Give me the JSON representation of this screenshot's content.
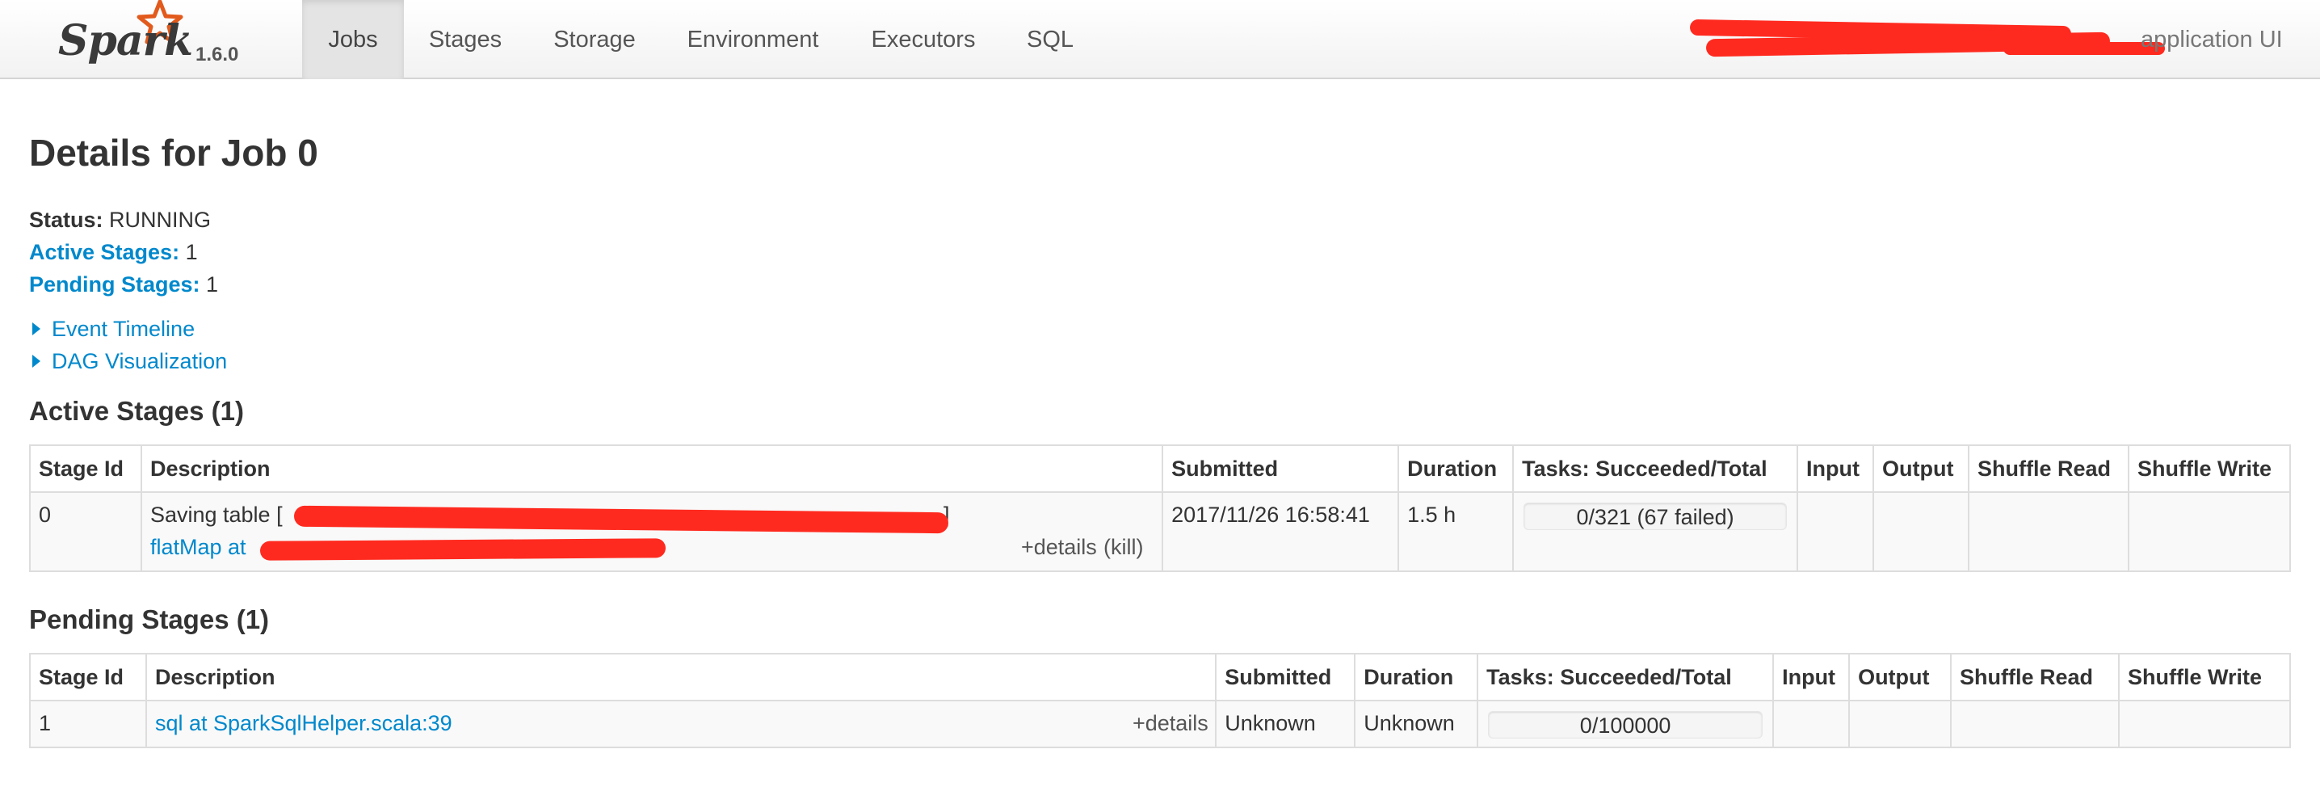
{
  "navbar": {
    "brand_name": "Spark",
    "brand_version": "1.6.0",
    "tabs": [
      "Jobs",
      "Stages",
      "Storage",
      "Environment",
      "Executors",
      "SQL"
    ],
    "active_tab": "Jobs",
    "app_title": "application UI",
    "brand_color": "#e25a1c"
  },
  "page": {
    "title": "Details for Job 0",
    "status_label": "Status:",
    "status_value": "RUNNING",
    "active_stages_label": "Active Stages:",
    "active_stages_value": "1",
    "pending_stages_label": "Pending Stages:",
    "pending_stages_value": "1",
    "event_timeline": "Event Timeline",
    "dag_visualization": "DAG Visualization"
  },
  "active_stages": {
    "heading": "Active Stages (1)",
    "columns": [
      "Stage Id",
      "Description",
      "Submitted",
      "Duration",
      "Tasks: Succeeded/Total",
      "Input",
      "Output",
      "Shuffle Read",
      "Shuffle Write"
    ],
    "rows": [
      {
        "stage_id": "0",
        "description": "Saving table [",
        "description_suffix": "]",
        "call_site": "flatMap at ",
        "details": "+details",
        "kill": "(kill)",
        "submitted": "2017/11/26 16:58:41",
        "duration": "1.5 h",
        "tasks": "0/321 (67 failed)",
        "tasks_progress": 0,
        "input": "",
        "output": "",
        "shuffle_read": "",
        "shuffle_write": ""
      }
    ]
  },
  "pending_stages": {
    "heading": "Pending Stages (1)",
    "columns": [
      "Stage Id",
      "Description",
      "Submitted",
      "Duration",
      "Tasks: Succeeded/Total",
      "Input",
      "Output",
      "Shuffle Read",
      "Shuffle Write"
    ],
    "rows": [
      {
        "stage_id": "1",
        "description": "sql at SparkSqlHelper.scala:39",
        "details": "+details",
        "submitted": "Unknown",
        "duration": "Unknown",
        "tasks": "0/100000",
        "tasks_progress": 0,
        "input": "",
        "output": "",
        "shuffle_read": "",
        "shuffle_write": ""
      }
    ]
  },
  "colors": {
    "link": "#0088cc",
    "redaction": "#ff2a1f"
  }
}
